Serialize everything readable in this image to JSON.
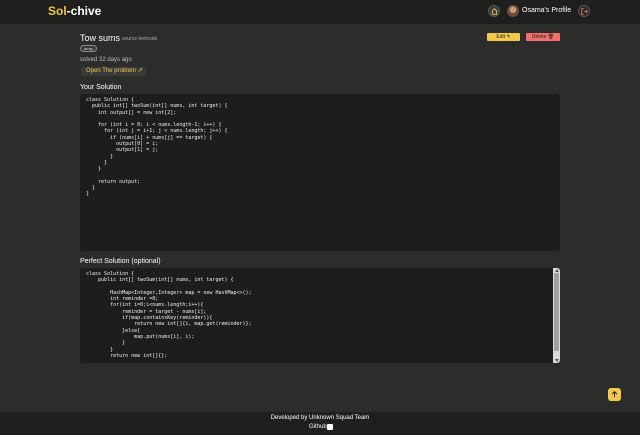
{
  "header": {
    "brand_part1": "Sol",
    "brand_part2": "-chive",
    "profile_label": "Osama's Profile",
    "icons": {
      "home": "home-icon",
      "logout": "logout-icon",
      "avatar": "avatar-image"
    }
  },
  "problem": {
    "title": "Tow sums",
    "source": "source leetcode",
    "tag": "array",
    "solved": "solved 32 days ago",
    "open_label": "Open The problem ↗",
    "edit_label": "Edit ✎",
    "delete_label": "Delete 🗑"
  },
  "solution": {
    "label": "Your Solution",
    "code": "class Solution {\n  public int[] twoSum(int[] nums, int target) {\n    int output[] = new int[2];\n\n    for (int i = 0; i < nums.length-1; i++) {\n      for (int j = i+1; j < nums.length; j++) {\n        if (nums[i] + nums[j] == target) {\n          output[0] = i;\n          output[1] = j;\n        }\n      }\n    }\n\n    return output;\n  }\n}"
  },
  "perfect": {
    "label": "Perfect Solution (optional)",
    "code": "class Solution {\n    public int[] twoSum(int[] nums, int target) {\n\n        HashMap<Integer,Integer> map = new HashMap<>();\n        int reminder =0;\n        for(int i=0;i<nums.length;i++){\n            reminder = target - nums[i];\n            if(map.containsKey(reminder)){\n                return new int[]{i, map.get(reminder)};\n            }else{\n                map.put(nums[i], i);\n            }\n        }\n        return new int[]{};"
  },
  "footer": {
    "credit": "Developed by Unknown Squad Team",
    "github": "Github"
  },
  "colors": {
    "accent": "#f2c94c",
    "danger": "#ef6f6c",
    "background": "#2c2c2b",
    "navbar": "#1f1f1e",
    "code_bg": "#1d1d1c"
  }
}
